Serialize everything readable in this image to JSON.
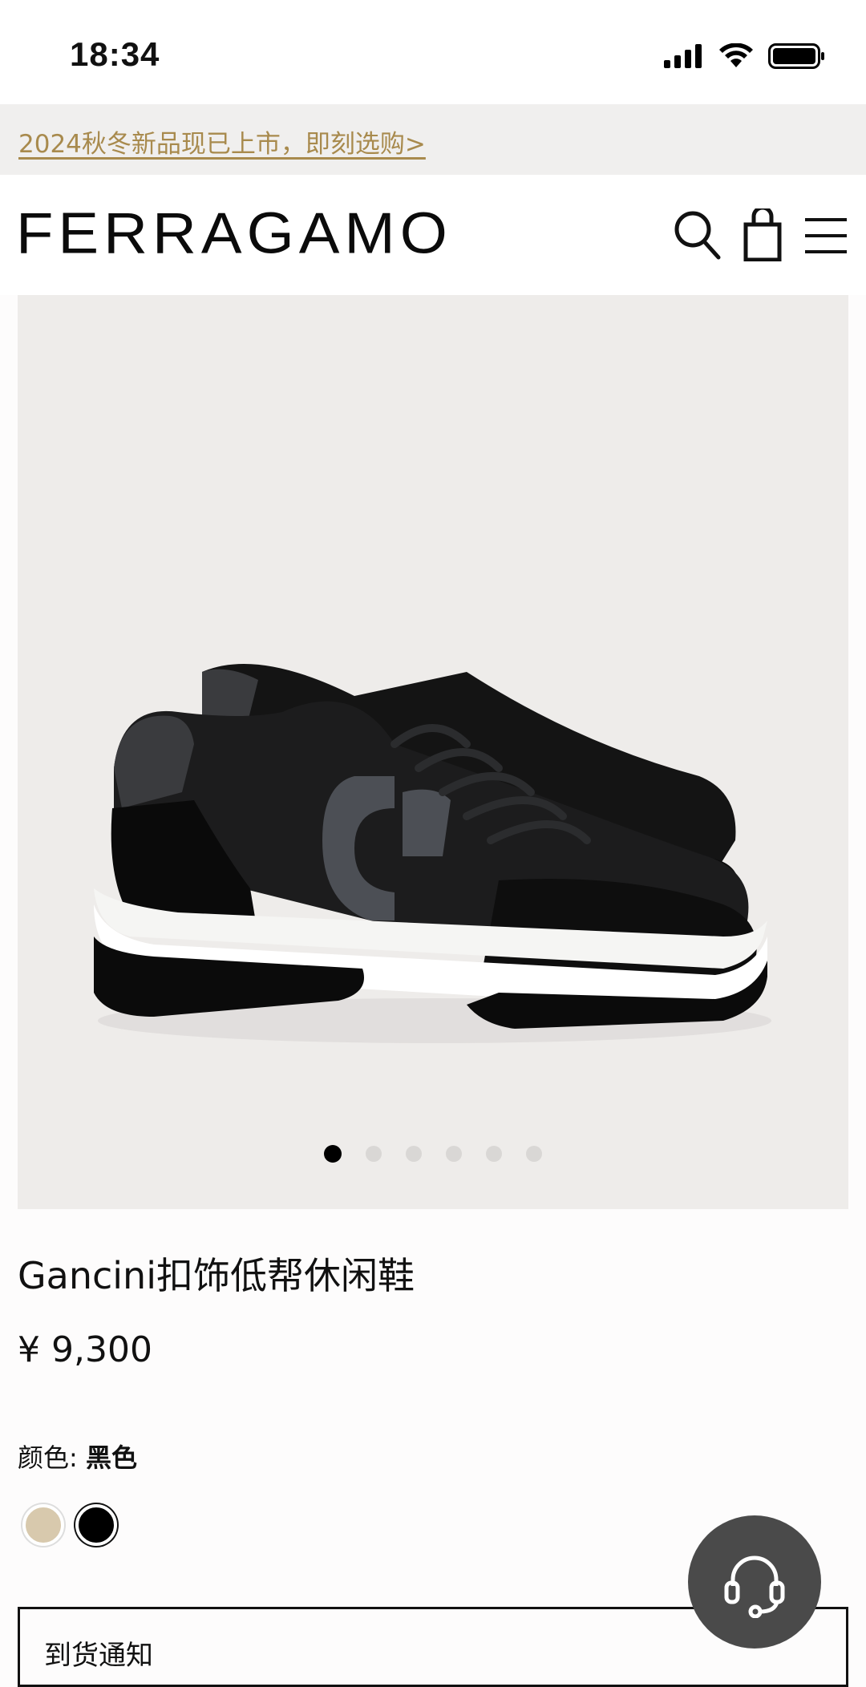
{
  "status_bar": {
    "time": "18:34"
  },
  "promo": {
    "text": "2024秋冬新品现已上市，即刻选购>"
  },
  "header": {
    "logo": "FERRAGAMO",
    "icons": [
      "search-icon",
      "shopping-bag-icon",
      "menu-icon"
    ]
  },
  "gallery": {
    "image_count": 6,
    "active_index": 0
  },
  "product": {
    "title": "Gancini扣饰低帮休闲鞋",
    "price": "¥ 9,300",
    "color_label": "颜色:",
    "color_value": "黑色",
    "swatches": [
      {
        "name": "beige",
        "color": "#d8c9ad"
      },
      {
        "name": "black",
        "color": "#000000"
      }
    ]
  },
  "notify": {
    "label": "到货通知"
  },
  "support": {
    "icon": "customer-service-headset-icon"
  },
  "colors": {
    "accent_gold": "#a88a4d",
    "banner_bg": "#f0efee",
    "gallery_bg": "#eeecea"
  }
}
